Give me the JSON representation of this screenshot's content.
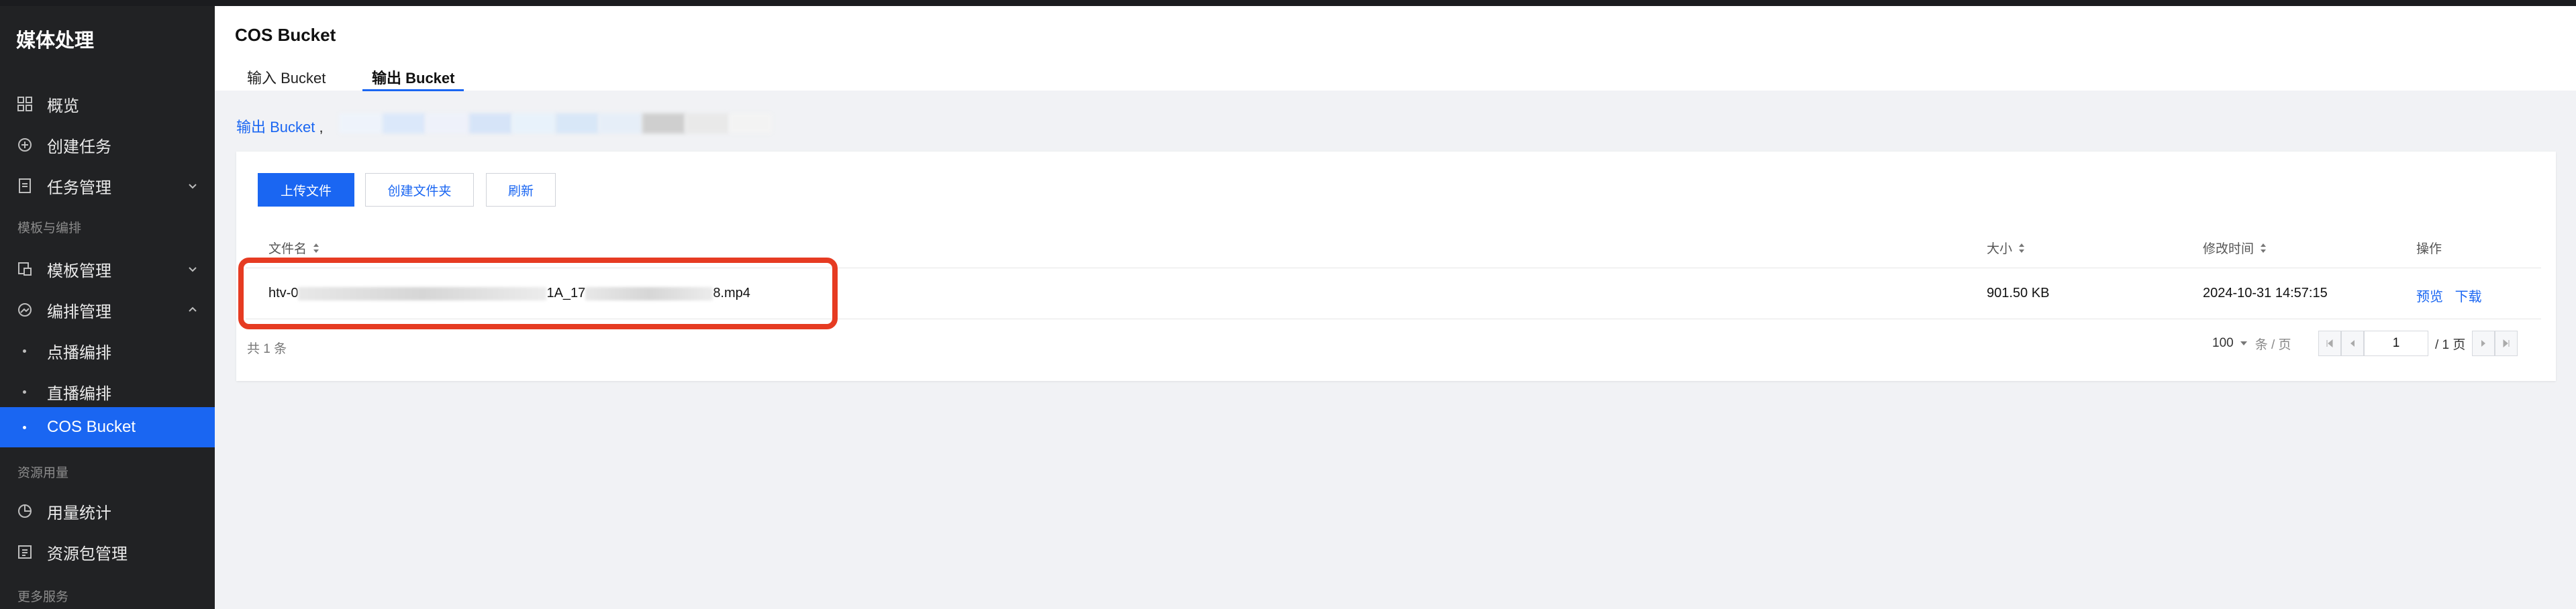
{
  "sidebar": {
    "brand": "媒体处理",
    "items": [
      {
        "label": "概览"
      },
      {
        "label": "创建任务"
      },
      {
        "label": "任务管理"
      },
      {
        "label": "模板管理"
      },
      {
        "label": "编排管理"
      },
      {
        "label": "点播编排"
      },
      {
        "label": "直播编排"
      },
      {
        "label": "COS Bucket"
      },
      {
        "label": "用量统计"
      },
      {
        "label": "资源包管理"
      }
    ],
    "groups": [
      "模板与编排",
      "资源用量",
      "更多服务"
    ]
  },
  "header": {
    "title": "COS Bucket",
    "tabs": [
      {
        "label": "输入 Bucket"
      },
      {
        "label": "输出 Bucket"
      }
    ]
  },
  "bucket": {
    "label": "输出 Bucket",
    "separator": ","
  },
  "toolbar": {
    "upload": "上传文件",
    "create_folder": "创建文件夹",
    "refresh": "刷新"
  },
  "table": {
    "columns": [
      "文件名",
      "大小",
      "修改时间",
      "操作"
    ],
    "rows": [
      {
        "name_prefix": "htv-0",
        "name_mid": "1A_17",
        "name_suffix": "8.mp4",
        "size": "901.50 KB",
        "modified": "2024-10-31 14:57:15",
        "ops": [
          "预览",
          "下载"
        ]
      }
    ]
  },
  "footer": {
    "total": "共 1 条",
    "page_size": "100",
    "per_page_unit": "条 / 页",
    "page": "1",
    "page_total": "/ 1 页"
  },
  "colors": {
    "accent": "#1a66f2",
    "sidebar_bg": "#212224",
    "highlight": "#e63b22"
  }
}
